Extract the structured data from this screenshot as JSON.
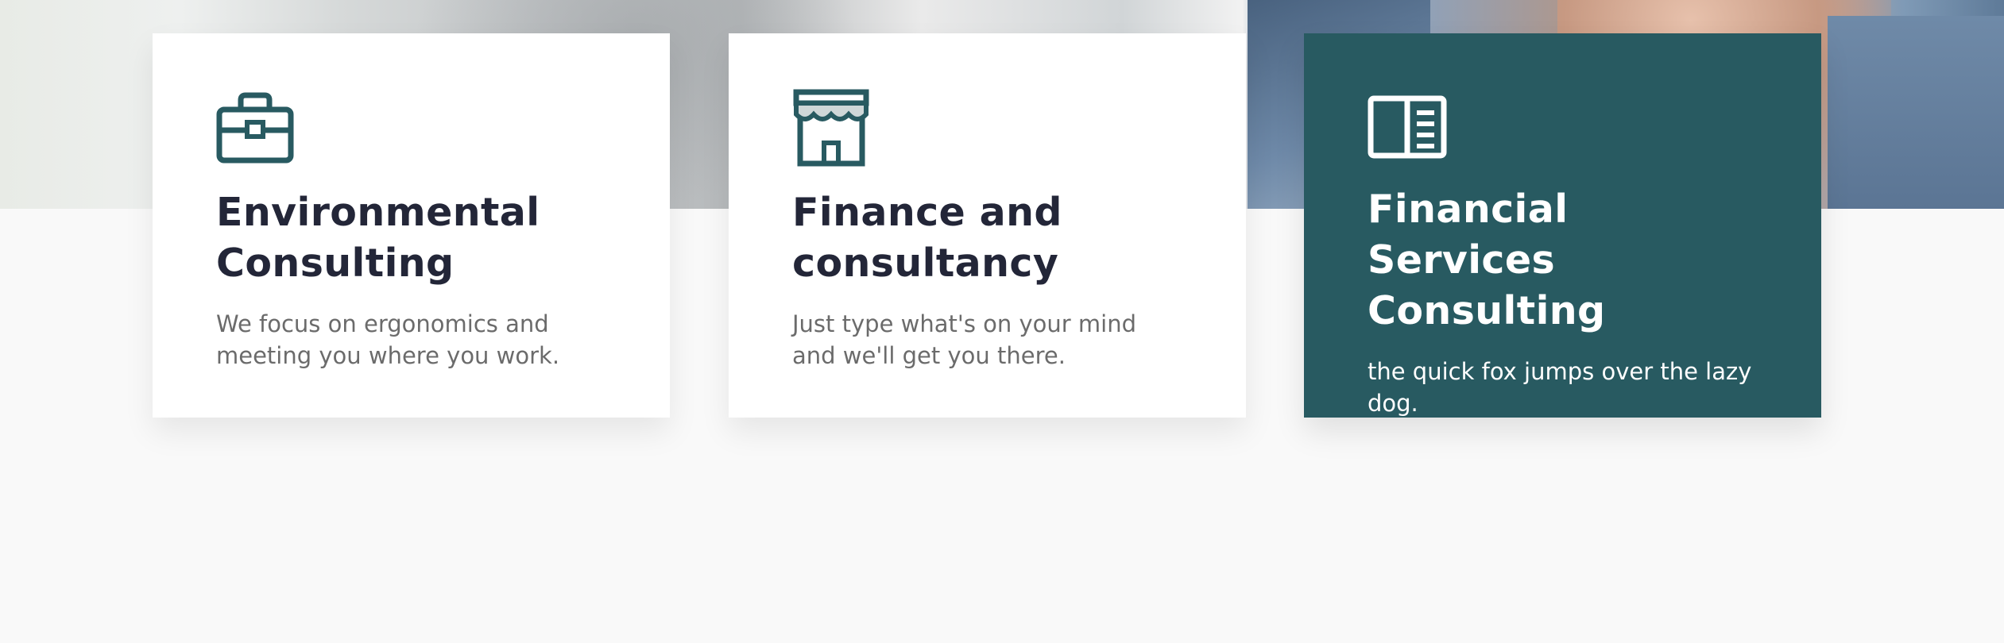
{
  "hero": {
    "alt": "background photo of people working"
  },
  "cards": [
    {
      "icon": "briefcase-icon",
      "title": "Environmental Consulting",
      "description": "We focus on ergonomics and meeting you where you work."
    },
    {
      "icon": "storefront-icon",
      "title": "Finance and consultancy",
      "description": "Just type what's on your mind and we'll get you there."
    },
    {
      "icon": "book-icon",
      "title": "Financial Services Consulting",
      "description": "the quick fox jumps over the lazy dog."
    }
  ],
  "colors": {
    "accent": "#285a61",
    "heading": "#232638",
    "body_text": "#6b6b6b",
    "background": "#f9f9f9"
  }
}
